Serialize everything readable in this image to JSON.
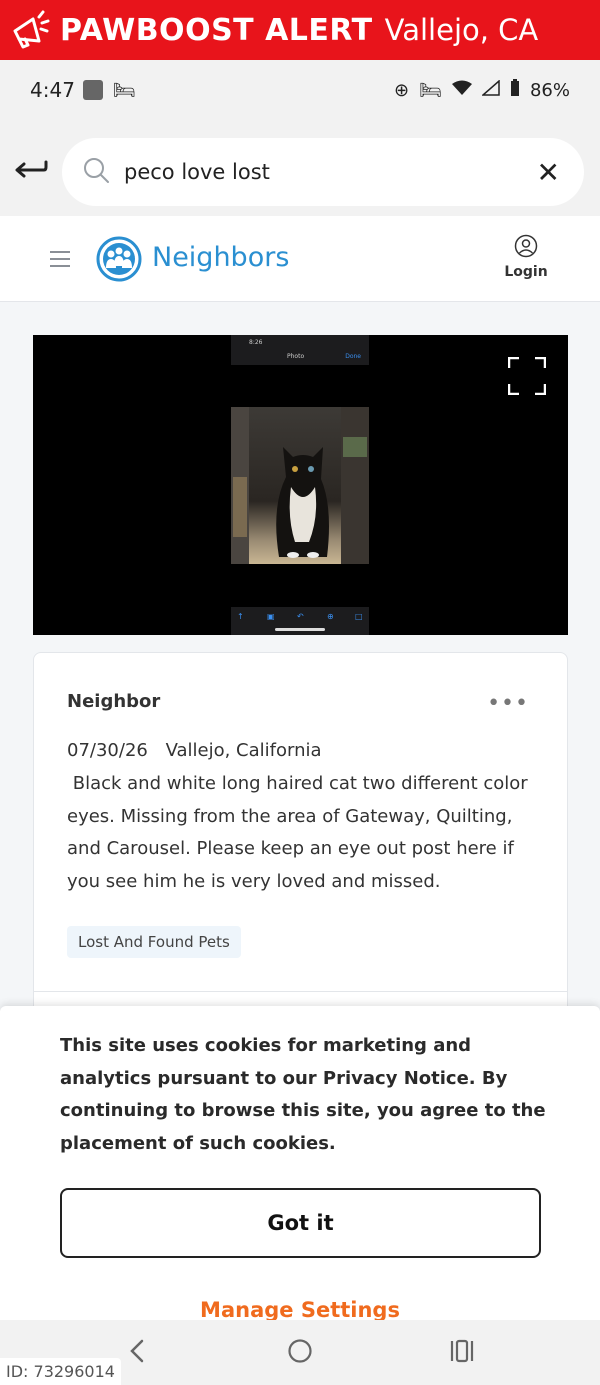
{
  "alert": {
    "brand": "PAWBOOST ALERT",
    "location": "Vallejo, CA",
    "icon": "megaphone-icon"
  },
  "status": {
    "time": "4:47",
    "battery": "86%"
  },
  "search": {
    "query": "peco love lost"
  },
  "header": {
    "brand": "Neighbors",
    "login": "Login"
  },
  "post": {
    "author": "Neighbor",
    "date": "07/30/26",
    "place": "Vallejo, California",
    "body": " Black and white long haired cat two different color eyes. Missing from the area of Gateway, Quilting, and Carousel. Please keep an eye out post here if you see him he is very loved and missed.",
    "tag": "Lost And Found Pets",
    "photo": {
      "screen_time": "8:26",
      "screen_title": "Photo",
      "screen_done": "Done"
    }
  },
  "cookie": {
    "message": "This site uses cookies for marketing and analytics pursuant to our Privacy Notice. By continuing to browse this site, you agree to the placement of such cookies.",
    "button": "Got it",
    "manage": "Manage Settings"
  },
  "footer": {
    "id_label": "ID: 73296014"
  },
  "colors": {
    "alert_red": "#e8141b",
    "brand_blue": "#2a8fd1",
    "manage_orange": "#f06b1e"
  }
}
